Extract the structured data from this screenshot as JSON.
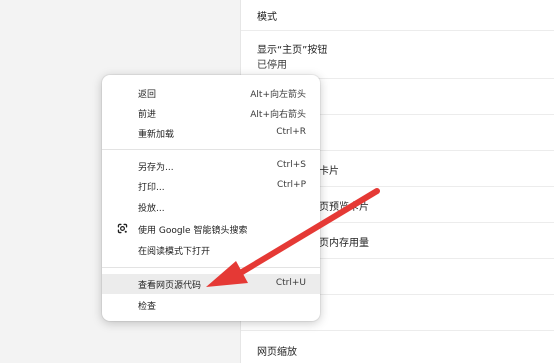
{
  "settings": {
    "mode": "模式",
    "show_home": "显示“主页”按钮",
    "show_home_state": "已停用",
    "tab_cards": "卡片",
    "preview": "页预览卡片",
    "memory": "页内存用量",
    "page_zoom": "网页缩放"
  },
  "menu": {
    "back": {
      "label": "返回",
      "shortcut": "Alt+向左箭头"
    },
    "forward": {
      "label": "前进",
      "shortcut": "Alt+向右箭头"
    },
    "reload": {
      "label": "重新加载",
      "shortcut": "Ctrl+R"
    },
    "save_as": {
      "label": "另存为...",
      "shortcut": "Ctrl+S"
    },
    "print": {
      "label": "打印...",
      "shortcut": "Ctrl+P"
    },
    "cast": {
      "label": "投放..."
    },
    "lens": {
      "label": "使用 Google 智能镜头搜索",
      "icon": "google-lens-icon"
    },
    "reader": {
      "label": "在阅读模式下打开"
    },
    "view_source": {
      "label": "查看网页源代码",
      "shortcut": "Ctrl+U"
    },
    "inspect": {
      "label": "检查"
    }
  },
  "colors": {
    "arrow": "#e53935",
    "highlight": "#ececec"
  }
}
